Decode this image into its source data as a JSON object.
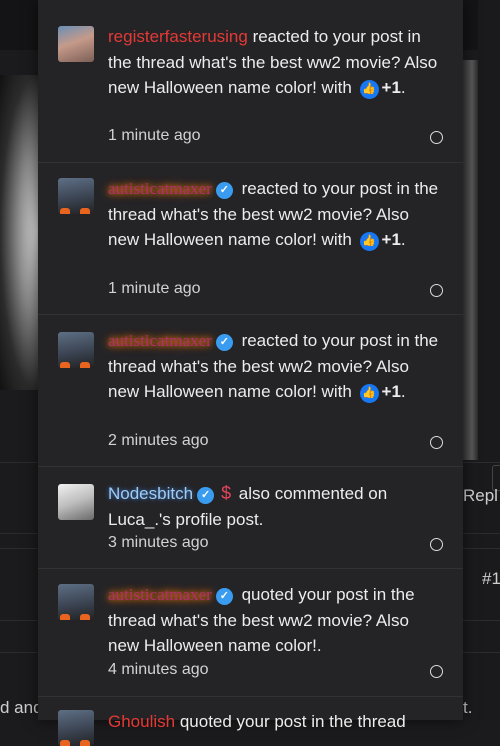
{
  "background": {
    "reply_label": "Repl",
    "post_number": "#1",
    "left_fragment": "d and",
    "right_fragment": "t."
  },
  "notifications": [
    {
      "username": "registerfasterusing",
      "action": " reacted to your post in the thread what's the best ww2 movie? Also new Halloween name color! with ",
      "reaction": "+1",
      "suffix": ".",
      "time": "1 minute ago"
    },
    {
      "username": "autisticatmaxer",
      "action": " reacted to your post in the thread what's the best ww2 movie? Also new Halloween name color! with ",
      "reaction": "+1",
      "suffix": ".",
      "time": "1 minute ago"
    },
    {
      "username": "autisticatmaxer",
      "action": " reacted to your post in the thread what's the best ww2 movie? Also new Halloween name color! with ",
      "reaction": "+1",
      "suffix": ".",
      "time": "2 minutes ago"
    },
    {
      "username": "Nodesbitch",
      "action": " also commented on Luca_.'s profile post.",
      "time": "3 minutes ago"
    },
    {
      "username": "autisticatmaxer",
      "action": " quoted your post in the thread what's the best ww2 movie? Also new Halloween name color!.",
      "time": "4 minutes ago"
    },
    {
      "username": "Ghoulish",
      "action": " quoted your post in the thread"
    }
  ],
  "icons": {
    "verified": "verified-check-icon",
    "like": "thumbs-up-icon",
    "dollar": "dollar-icon",
    "mark_read": "circle-mark-read-icon"
  },
  "colors": {
    "red_user": "#e53935",
    "purple_user": "#b0306d",
    "blue_user": "#9ecbf5",
    "verified": "#3a9cf0",
    "like": "#1877f2"
  }
}
